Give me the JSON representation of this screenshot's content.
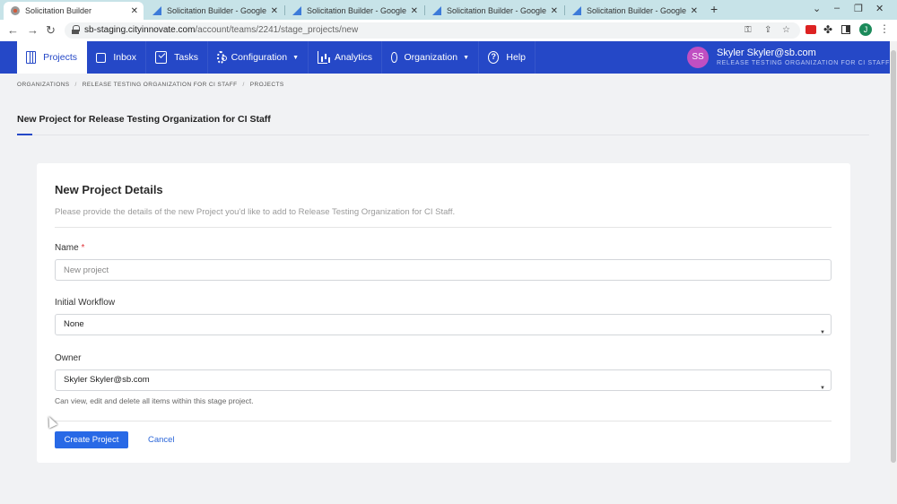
{
  "browser": {
    "tabs": [
      {
        "title": "Solicitation Builder",
        "favicon": "solicitation-builder-icon",
        "active": true
      },
      {
        "title": "Solicitation Builder - Google Chr",
        "favicon": "google-chat-icon",
        "active": false
      },
      {
        "title": "Solicitation Builder - Google Chr",
        "favicon": "google-chat-icon",
        "active": false
      },
      {
        "title": "Solicitation Builder - Google Chr",
        "favicon": "google-chat-icon",
        "active": false
      },
      {
        "title": "Solicitation Builder - Google Chr",
        "favicon": "google-chat-icon",
        "active": false
      }
    ],
    "url_host": "sb-staging.cityinnovate.com",
    "url_path": "/account/teams/2241/stage_projects/new",
    "profile_initial": "J"
  },
  "nav": {
    "items": [
      {
        "label": "Projects",
        "icon": "projects-icon"
      },
      {
        "label": "Inbox",
        "icon": "inbox-icon"
      },
      {
        "label": "Tasks",
        "icon": "tasks-icon"
      },
      {
        "label": "Configuration",
        "icon": "gear-icon"
      },
      {
        "label": "Analytics",
        "icon": "chart-icon"
      },
      {
        "label": "Organization",
        "icon": "organization-icon"
      },
      {
        "label": "Help",
        "icon": "help-icon"
      }
    ],
    "user": {
      "initials": "SS",
      "name": "Skyler Skyler@sb.com",
      "org": "RELEASE TESTING ORGANIZATION FOR CI STAFF"
    }
  },
  "breadcrumb": [
    "ORGANIZATIONS",
    "RELEASE TESTING ORGANIZATION FOR CI STAFF",
    "PROJECTS"
  ],
  "page_title": "New Project for Release Testing Organization for CI Staff",
  "form": {
    "title": "New Project Details",
    "description": "Please provide the details of the new Project you'd like to add to Release Testing Organization for CI Staff.",
    "name_label": "Name",
    "required_mark": "*",
    "name_placeholder": "New project",
    "workflow_label": "Initial Workflow",
    "workflow_value": "None",
    "owner_label": "Owner",
    "owner_value": "Skyler Skyler@sb.com",
    "owner_help": "Can view, edit and delete all items within this stage project.",
    "submit_label": "Create Project",
    "cancel_label": "Cancel"
  },
  "colors": {
    "nav_bg": "#2548c7",
    "primary": "#2869e6",
    "required": "#e0343a"
  }
}
